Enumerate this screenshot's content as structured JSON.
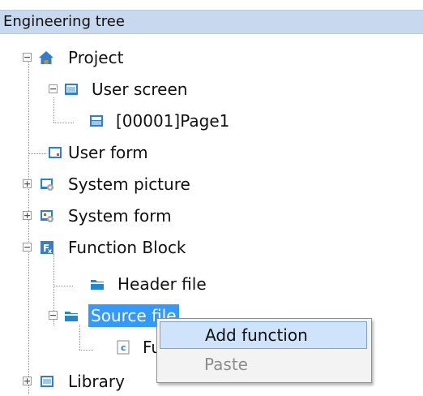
{
  "panel": {
    "title": "Engineering tree"
  },
  "tree": {
    "root_label": "Project",
    "items": [
      {
        "label": "User screen",
        "expander": "−",
        "icon": "screen-icon"
      },
      {
        "label": "[00001]Page1",
        "icon": "page-icon"
      },
      {
        "label": "User form",
        "icon": "form-icon"
      },
      {
        "label": "System picture",
        "expander": "+",
        "icon": "system-picture-icon"
      },
      {
        "label": "System form",
        "expander": "+",
        "icon": "system-form-icon"
      },
      {
        "label": "Function Block",
        "expander": "−",
        "icon": "function-block-icon"
      },
      {
        "label": "Header file",
        "icon": "folder-icon"
      },
      {
        "label": "Source file",
        "expander": "−",
        "icon": "folder-icon",
        "selected": true
      },
      {
        "label": "Fu",
        "icon": "c-file-icon"
      },
      {
        "label": "Library",
        "expander": "+",
        "icon": "library-icon"
      }
    ]
  },
  "context_menu": {
    "items": [
      {
        "label": "Add function",
        "enabled": true,
        "highlighted": true
      },
      {
        "label": "Paste",
        "enabled": false
      }
    ]
  },
  "colors": {
    "header_background": "#c8d8ee",
    "selection": "#3399ff",
    "menu_highlight": "#cfe3fb",
    "folder": "#1e88d4",
    "function_block": "#3b7dc4"
  }
}
